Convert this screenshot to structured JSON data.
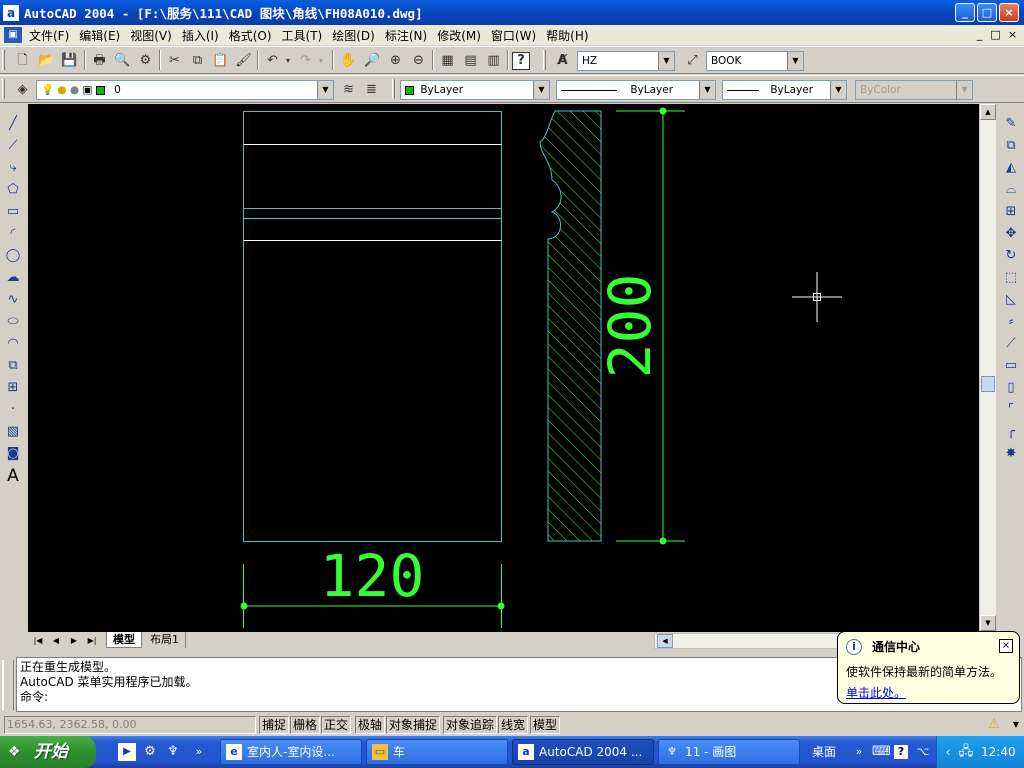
{
  "window": {
    "title": "AutoCAD 2004 - [F:\\服务\\111\\CAD 图块\\角线\\FH08A010.dwg]",
    "app_icon": "a",
    "min_label": "_",
    "max_label": "□",
    "close_label": "×"
  },
  "menu": {
    "items": [
      "文件(F)",
      "编辑(E)",
      "视图(V)",
      "插入(I)",
      "格式(O)",
      "工具(T)",
      "绘图(D)",
      "标注(N)",
      "修改(M)",
      "窗口(W)",
      "帮助(H)"
    ],
    "mdi_min": "_",
    "mdi_restore": "□",
    "mdi_close": "×"
  },
  "toolbar": {
    "text_style": "HZ",
    "dim_style": "BOOK"
  },
  "layers": {
    "current_layer": "0",
    "color": "ByLayer",
    "linetype": "ByLayer",
    "lineweight": "ByLayer",
    "plotstyle": "ByColor",
    "layer_color": "#00c000"
  },
  "drawing": {
    "dim_width": "120",
    "dim_height": "200",
    "line_color": "#3fc4c4",
    "dim_color": "#33ff33"
  },
  "tabs": {
    "model": "模型",
    "layout1": "布局1"
  },
  "command": {
    "line1": "正在重生成模型。",
    "line2": "AutoCAD 菜单实用程序已加载。",
    "prompt": "命令:"
  },
  "status": {
    "coords": "1654.63, 2362.58, 0.00",
    "buttons": [
      "捕捉",
      "栅格",
      "正交",
      "极轴",
      "对象捕捉",
      "对象追踪",
      "线宽",
      "模型"
    ]
  },
  "balloon": {
    "title": "通信中心",
    "message": "使软件保持最新的简单方法。",
    "link": "单击此处。",
    "close": "×"
  },
  "taskbar": {
    "start": "开始",
    "tasks": [
      "室内人-室内设...",
      "车",
      "AutoCAD 2004 ...",
      "11 - 画图"
    ],
    "desktop": "桌面",
    "clock": "12:40",
    "more": "»"
  }
}
